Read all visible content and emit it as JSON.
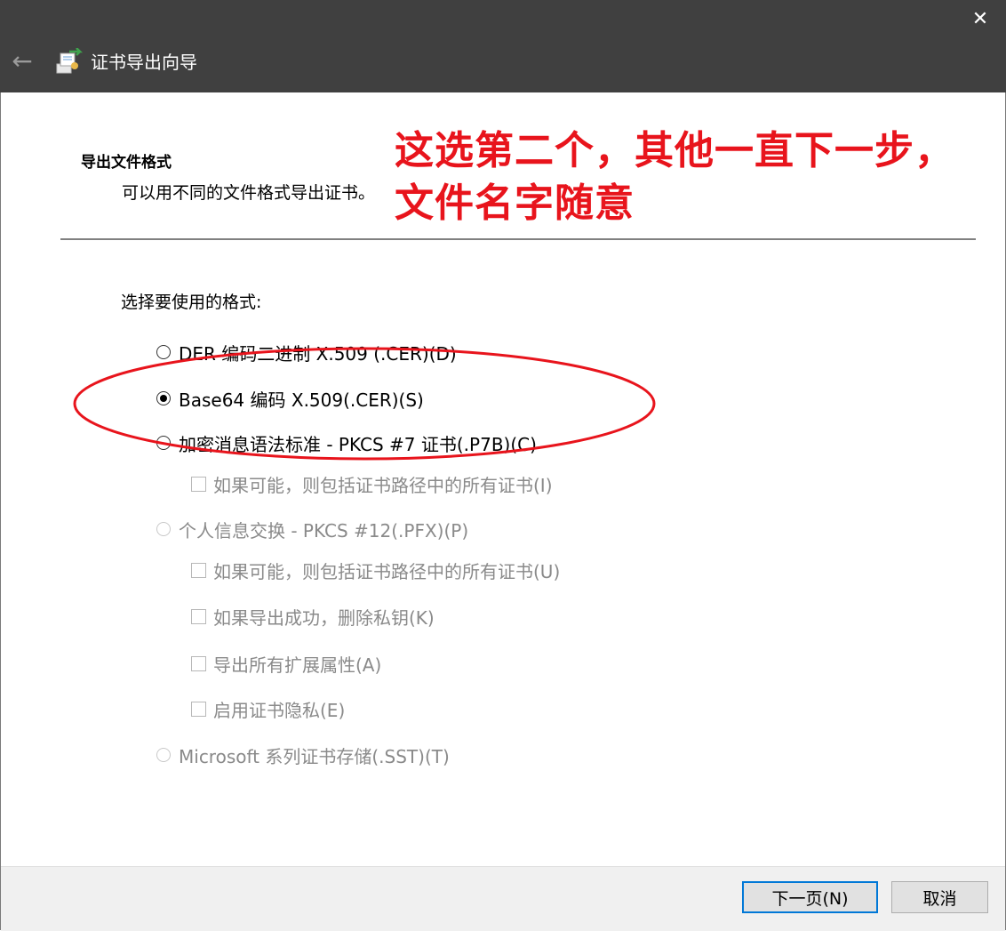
{
  "titlebar": {
    "back_icon": "arrow-left-icon",
    "app_icon": "certificate-wizard-icon",
    "title": "证书导出向导",
    "close_icon": "close-icon",
    "close_glyph": "✕",
    "back_glyph": "←"
  },
  "header": {
    "heading": "导出文件格式",
    "subheading": "可以用不同的文件格式导出证书。"
  },
  "annotation": {
    "line1": "这选第二个，其他一直下一步，",
    "line2": "文件名字随意",
    "color": "#e8141c"
  },
  "form": {
    "prompt": "选择要使用的格式:",
    "options": [
      {
        "label": "DER 编码二进制 X.509 (.CER)(D)",
        "selected": false,
        "enabled": true
      },
      {
        "label": "Base64 编码 X.509(.CER)(S)",
        "selected": true,
        "enabled": true
      },
      {
        "label": "加密消息语法标准 - PKCS #7 证书(.P7B)(C)",
        "selected": false,
        "enabled": true
      },
      {
        "label": "个人信息交换 - PKCS #12(.PFX)(P)",
        "selected": false,
        "enabled": false
      },
      {
        "label": "Microsoft 系列证书存储(.SST)(T)",
        "selected": false,
        "enabled": false
      }
    ],
    "checkboxes": [
      {
        "label": "如果可能，则包括证书路径中的所有证书(I)",
        "checked": false,
        "enabled": false
      },
      {
        "label": "如果可能，则包括证书路径中的所有证书(U)",
        "checked": false,
        "enabled": false
      },
      {
        "label": "如果导出成功，删除私钥(K)",
        "checked": false,
        "enabled": false
      },
      {
        "label": "导出所有扩展属性(A)",
        "checked": false,
        "enabled": false
      },
      {
        "label": "启用证书隐私(E)",
        "checked": false,
        "enabled": false
      }
    ]
  },
  "footer": {
    "next_label": "下一页(N)",
    "cancel_label": "取消",
    "accent": "#0078d7"
  }
}
